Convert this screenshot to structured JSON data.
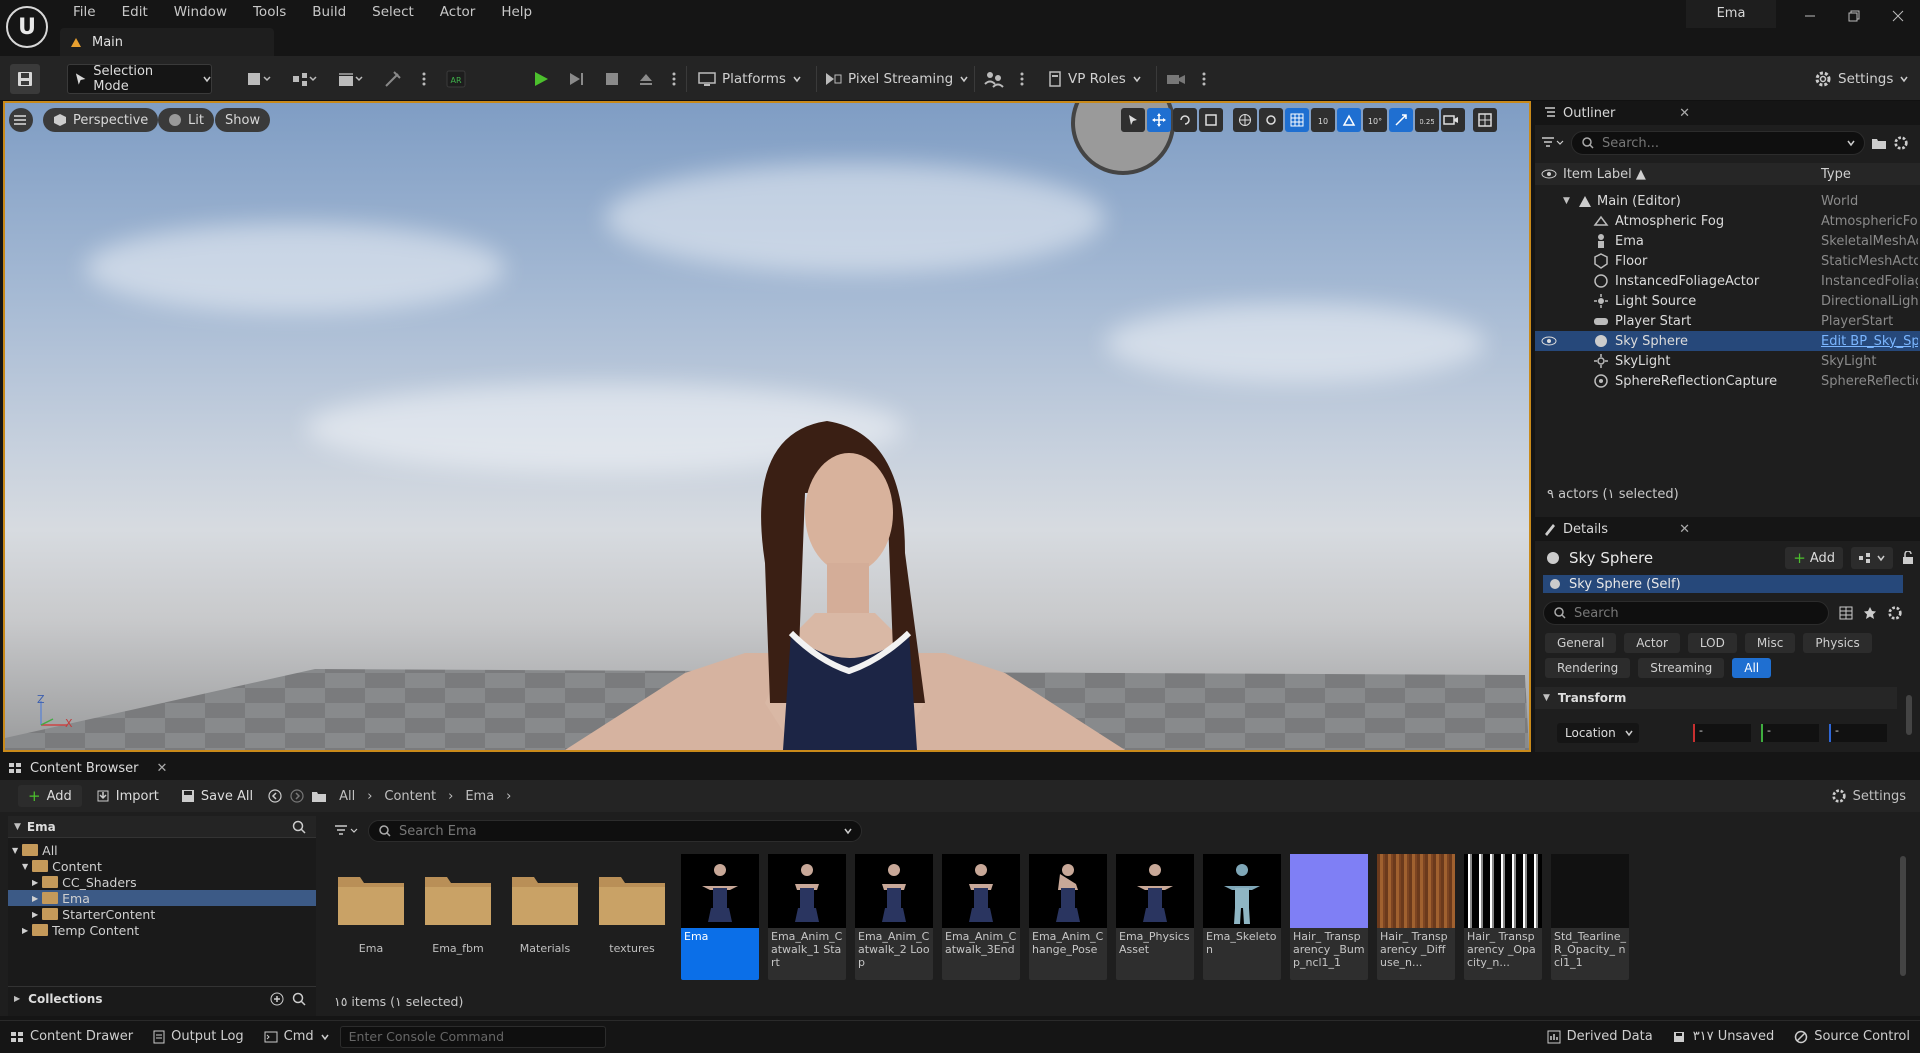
{
  "menu": [
    "File",
    "Edit",
    "Window",
    "Tools",
    "Build",
    "Select",
    "Actor",
    "Help"
  ],
  "main_tab": "Main",
  "project_name": "Ema",
  "toolbar": {
    "selection_mode": "Selection Mode",
    "platforms": "Platforms",
    "pixel_streaming": "Pixel Streaming",
    "vp_roles": "VP Roles",
    "settings": "Settings"
  },
  "viewport": {
    "perspective": "Perspective",
    "lit": "Lit",
    "show": "Show",
    "axis_z": "Z",
    "axis_x": "X"
  },
  "outliner": {
    "title": "Outliner",
    "search_placeholder": "Search...",
    "col_label": "Item Label ▲",
    "col_type": "Type",
    "rows": [
      {
        "label": "Main (Editor)",
        "type": "World"
      },
      {
        "label": "Atmospheric Fog",
        "type": "AtmosphericFog"
      },
      {
        "label": "Ema",
        "type": "SkeletalMeshAc"
      },
      {
        "label": "Floor",
        "type": "StaticMeshActor"
      },
      {
        "label": "InstancedFoliageActor",
        "type": "InstancedFoliage"
      },
      {
        "label": "Light Source",
        "type": "DirectionalLight"
      },
      {
        "label": "Player Start",
        "type": "PlayerStart"
      },
      {
        "label": "Sky Sphere",
        "type": "Edit BP_Sky_Sph"
      },
      {
        "label": "SkyLight",
        "type": "SkyLight"
      },
      {
        "label": "SphereReflectionCapture",
        "type": "SphereReflection"
      }
    ],
    "status": "٩ actors (١ selected)"
  },
  "details": {
    "title": "Details",
    "object": "Sky Sphere",
    "add": "Add",
    "self": "Sky Sphere (Self)",
    "search_placeholder": "Search",
    "categories_row1": [
      "General",
      "Actor",
      "LOD",
      "Misc",
      "Physics"
    ],
    "categories_row2": [
      "Rendering",
      "Streaming",
      "All"
    ],
    "section": "Transform",
    "location": "Location",
    "fields": [
      "-",
      "-",
      "-"
    ]
  },
  "content_browser": {
    "title": "Content Browser",
    "add": "Add",
    "import": "Import",
    "save_all": "Save All",
    "breadcrumb": [
      "All",
      "Content",
      "Ema"
    ],
    "settings": "Settings",
    "tree_search": "Ema",
    "tree": [
      "All",
      "Content",
      "CC_Shaders",
      "Ema",
      "StarterContent",
      "Temp Content"
    ],
    "collections": "Collections",
    "search_placeholder": "Search Ema",
    "folders": [
      "Ema",
      "Ema_fbm",
      "Materials",
      "textures"
    ],
    "assets": [
      "Ema",
      "Ema_Anim_Catwalk_1 Start",
      "Ema_Anim_Catwalk_2 Loop",
      "Ema_Anim_Catwalk_3End",
      "Ema_Anim_Change_Pose",
      "Ema_Physics Asset",
      "Ema_Skeleton",
      "Hair_ Transparency _Bump_ncl1_1",
      "Hair_ Transparency _Diffuse_n...",
      "Hair_ Transparency _Opacity_n...",
      "Std_Tearline_ R_Opacity_ ncl1_1"
    ],
    "status": "١٥ items (١ selected)"
  },
  "statusbar": {
    "content_drawer": "Content Drawer",
    "output_log": "Output Log",
    "cmd": "Cmd",
    "console_placeholder": "Enter Console Command",
    "derived_data": "Derived Data",
    "unsaved": "٣١٧ Unsaved",
    "source_control": "Source Control"
  }
}
